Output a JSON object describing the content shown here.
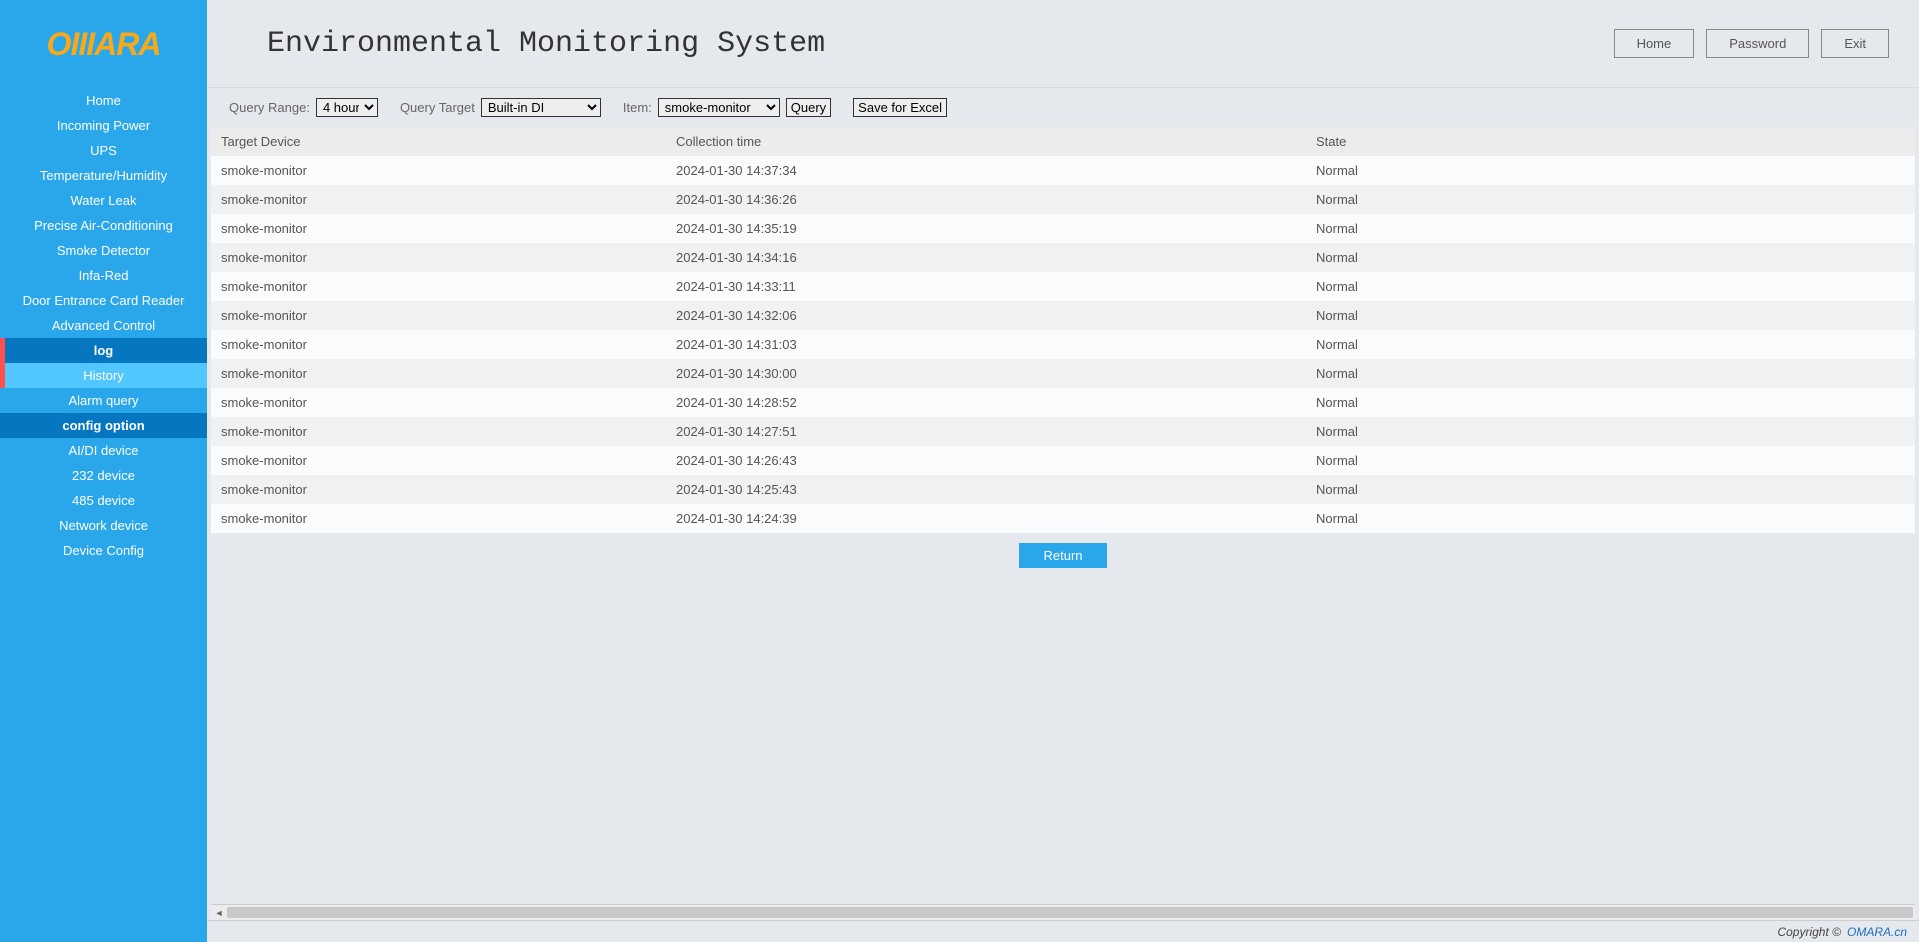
{
  "logo": "OIIIARA",
  "header": {
    "title": "Environmental Monitoring System",
    "buttons": {
      "home": "Home",
      "password": "Password",
      "exit": "Exit"
    }
  },
  "sidebar": {
    "items": [
      {
        "label": "Home",
        "kind": "item"
      },
      {
        "label": "Incoming Power",
        "kind": "item"
      },
      {
        "label": "UPS",
        "kind": "item"
      },
      {
        "label": "Temperature/Humidity",
        "kind": "item"
      },
      {
        "label": "Water Leak",
        "kind": "item"
      },
      {
        "label": "Precise Air-Conditioning",
        "kind": "item"
      },
      {
        "label": "Smoke Detector",
        "kind": "item"
      },
      {
        "label": "Infa-Red",
        "kind": "item"
      },
      {
        "label": "Door Entrance Card Reader",
        "kind": "item"
      },
      {
        "label": "Advanced Control",
        "kind": "item"
      },
      {
        "label": "log",
        "kind": "section-active"
      },
      {
        "label": "History",
        "kind": "item-active"
      },
      {
        "label": "Alarm query",
        "kind": "item"
      },
      {
        "label": "config option",
        "kind": "section-header"
      },
      {
        "label": "AI/DI device",
        "kind": "item"
      },
      {
        "label": "232 device",
        "kind": "item"
      },
      {
        "label": "485 device",
        "kind": "item"
      },
      {
        "label": "Network device",
        "kind": "item"
      },
      {
        "label": "Device Config",
        "kind": "item"
      }
    ]
  },
  "query": {
    "range_label": "Query Range:",
    "range_value": "4 hours",
    "target_label": "Query Target",
    "target_value": "Built-in DI",
    "item_label": "Item:",
    "item_value": "smoke-monitor",
    "query_btn": "Query",
    "save_btn": "Save for Excel"
  },
  "table": {
    "headers": {
      "device": "Target Device",
      "time": "Collection time",
      "state": "State"
    },
    "rows": [
      {
        "device": "smoke-monitor",
        "time": "2024-01-30 14:37:34",
        "state": "Normal"
      },
      {
        "device": "smoke-monitor",
        "time": "2024-01-30 14:36:26",
        "state": "Normal"
      },
      {
        "device": "smoke-monitor",
        "time": "2024-01-30 14:35:19",
        "state": "Normal"
      },
      {
        "device": "smoke-monitor",
        "time": "2024-01-30 14:34:16",
        "state": "Normal"
      },
      {
        "device": "smoke-monitor",
        "time": "2024-01-30 14:33:11",
        "state": "Normal"
      },
      {
        "device": "smoke-monitor",
        "time": "2024-01-30 14:32:06",
        "state": "Normal"
      },
      {
        "device": "smoke-monitor",
        "time": "2024-01-30 14:31:03",
        "state": "Normal"
      },
      {
        "device": "smoke-monitor",
        "time": "2024-01-30 14:30:00",
        "state": "Normal"
      },
      {
        "device": "smoke-monitor",
        "time": "2024-01-30 14:28:52",
        "state": "Normal"
      },
      {
        "device": "smoke-monitor",
        "time": "2024-01-30 14:27:51",
        "state": "Normal"
      },
      {
        "device": "smoke-monitor",
        "time": "2024-01-30 14:26:43",
        "state": "Normal"
      },
      {
        "device": "smoke-monitor",
        "time": "2024-01-30 14:25:43",
        "state": "Normal"
      },
      {
        "device": "smoke-monitor",
        "time": "2024-01-30 14:24:39",
        "state": "Normal"
      }
    ]
  },
  "return_btn": "Return",
  "footer": {
    "copyright": "Copyright ©",
    "link": "OMARA.cn"
  }
}
